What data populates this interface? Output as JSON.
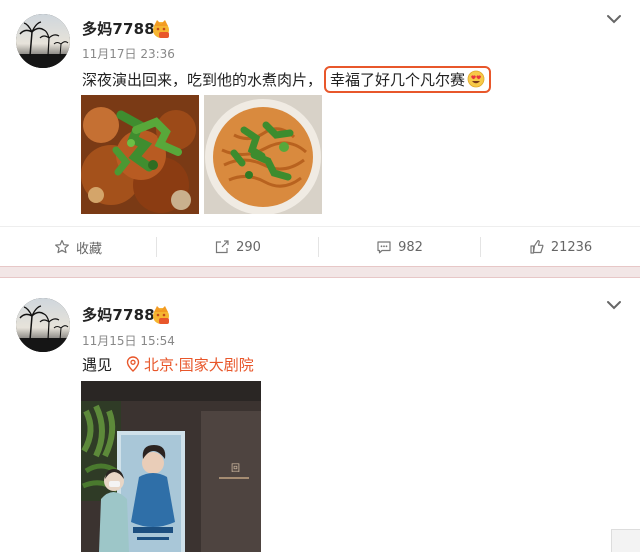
{
  "posts": [
    {
      "username": "多妈7788",
      "timestamp": "11月17日 23:36",
      "text_plain": "深夜演出回来，吃到他的水煮肉片，",
      "text_highlight": "幸福了好几个凡尔赛",
      "emoji": "heart-eyes-emoji",
      "images": [
        "spicy-fish-photo",
        "shredded-dish-photo"
      ],
      "actions": {
        "favorite_label": "收藏",
        "share_count": "290",
        "comment_count": "982",
        "like_count": "21236"
      }
    },
    {
      "username": "多妈7788",
      "timestamp": "11月15日 15:54",
      "text_plain": "遇见",
      "location": "北京·国家大剧院",
      "images": [
        "theater-poster-photo"
      ]
    }
  ],
  "colors": {
    "accent": "#e8572b",
    "divider": "#f2e6e6",
    "muted": "#888888"
  }
}
